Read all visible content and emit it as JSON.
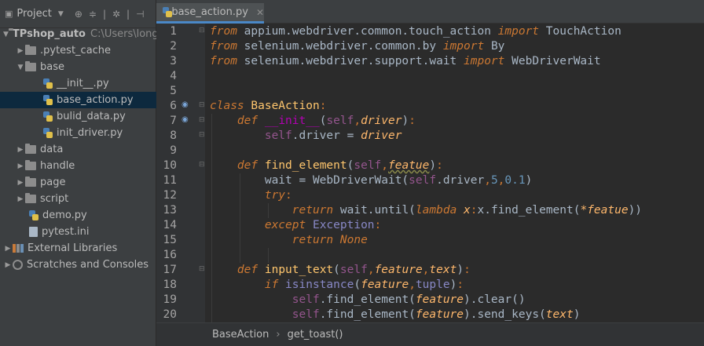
{
  "sidebar": {
    "title": "Project",
    "items": [
      {
        "label": "TPshop_auto",
        "extra": "C:\\Users\\long",
        "type": "root"
      },
      {
        "label": ".pytest_cache",
        "type": "folder"
      },
      {
        "label": "base",
        "type": "folder"
      },
      {
        "label": "__init__.py",
        "type": "py"
      },
      {
        "label": "base_action.py",
        "type": "py"
      },
      {
        "label": "bulid_data.py",
        "type": "py"
      },
      {
        "label": "init_driver.py",
        "type": "py"
      },
      {
        "label": "data",
        "type": "folder"
      },
      {
        "label": "handle",
        "type": "folder"
      },
      {
        "label": "page",
        "type": "folder"
      },
      {
        "label": "script",
        "type": "folder"
      },
      {
        "label": "demo.py",
        "type": "py"
      },
      {
        "label": "pytest.ini",
        "type": "ini"
      },
      {
        "label": "External Libraries",
        "type": "lib"
      },
      {
        "label": "Scratches and Consoles",
        "type": "scratch"
      }
    ]
  },
  "editor": {
    "tab_label": "base_action.py",
    "line_numbers": [
      "1",
      "2",
      "3",
      "4",
      "5",
      "6",
      "7",
      "8",
      "9",
      "10",
      "11",
      "12",
      "13",
      "14",
      "15",
      "16",
      "17",
      "18",
      "19",
      "20"
    ]
  },
  "breadcrumb": {
    "class": "BaseAction",
    "method": "get_toast()"
  }
}
